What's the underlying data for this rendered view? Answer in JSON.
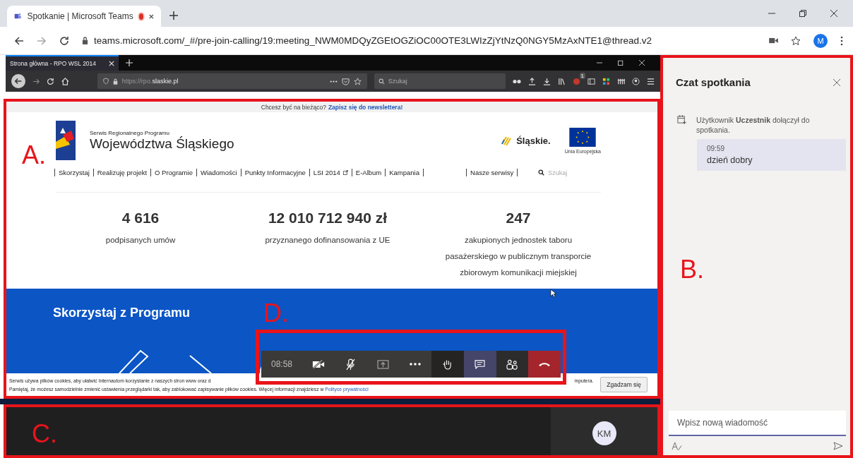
{
  "browser": {
    "tabs": [
      {
        "title": "Spotkanie | Microsoft Teams",
        "recording": true,
        "selected": true
      }
    ],
    "url": "teams.microsoft.com/_#/pre-join-calling/19:meeting_NWM0MDQyZGEtOGZiOC00OTE3LWIzZjYtNzQ0NGY5MzAxNTE1@thread.v2",
    "profile_initial": "M"
  },
  "shared_screen": {
    "annotation": "A.",
    "tab_title": "Strona główna - RPO WSL 2014",
    "url_prefix": "https://rpo.",
    "url_domain": "slaskie.pl",
    "search_placeholder": "Szukaj",
    "notification_badge": "1",
    "page": {
      "newsletter_prompt": "Chcesz być na bieżąco?",
      "newsletter_link": "Zapisz się do newslettera!",
      "brand_subtitle": "Serwis Regionalnego Programu",
      "brand_title": "Województwa Śląskiego",
      "partner": "Śląskie.",
      "eu_label": "Unia Europejska",
      "nav": [
        {
          "label": "Skorzystaj",
          "external": false
        },
        {
          "label": "Realizuję projekt",
          "external": false
        },
        {
          "label": "O Programie",
          "external": false
        },
        {
          "label": "Wiadomości",
          "external": false
        },
        {
          "label": "Punkty Informacyjne",
          "external": false
        },
        {
          "label": "LSI 2014",
          "external": true
        },
        {
          "label": "E-Album",
          "external": false
        },
        {
          "label": "Kampania",
          "external": false
        }
      ],
      "nav_right": "Nasze serwisy",
      "search_placeholder": "Szukaj",
      "stats": [
        {
          "value": "4 616",
          "label": "podpisanych umów"
        },
        {
          "value": "12 010 712 940 zł",
          "label": "przyznanego dofinansowania z UE"
        },
        {
          "value": "247",
          "label": "zakupionych jednostek taboru pasażerskiego w publicznym transporcie zbiorowym komunikacji miejskiej"
        }
      ],
      "section_title": "Skorzystaj z Programu",
      "cookie_text_1": "Serwis używa plików cookies, aby ułatwić Internautom korzystanie z naszych stron www oraz d",
      "cookie_text_1_end": "mputera.",
      "cookie_text_2": "Pamiętaj, że możesz samodzielnie zmienić ustawienia przeglądarki tak, aby zablokować zapisywanie plików cookies. Więcej informacji znajdziesz w",
      "cookie_link": "Polityce prywatności",
      "cookie_button": "Zgadzam się"
    }
  },
  "call_controls": {
    "annotation": "D.",
    "timer": "08:58",
    "buttons": [
      {
        "kind": "camera-off",
        "selected": false
      },
      {
        "kind": "mic-off",
        "selected": false
      },
      {
        "kind": "share",
        "selected": false
      },
      {
        "kind": "more",
        "selected": false
      },
      {
        "kind": "raise-hand",
        "selected": false
      },
      {
        "kind": "chat",
        "selected": true
      },
      {
        "kind": "participants",
        "selected": false
      },
      {
        "kind": "hang-up",
        "selected": false
      }
    ]
  },
  "participants": {
    "annotation": "C.",
    "initials": "KM"
  },
  "chat": {
    "annotation": "B.",
    "title": "Czat spotkania",
    "events": [
      {
        "text": "Użytkownik **Uczestnik** dołączył do spotkania."
      }
    ],
    "messages": [
      {
        "time": "09:59",
        "text": "dzień dobry"
      }
    ],
    "compose_placeholder": "Wpisz nową wiadomość"
  }
}
